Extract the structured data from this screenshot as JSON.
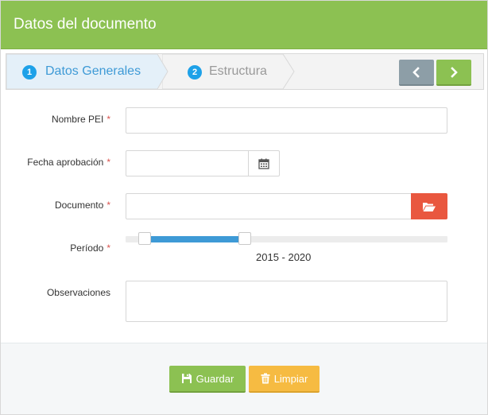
{
  "panel": {
    "title": "Datos del documento"
  },
  "wizard": {
    "steps": [
      {
        "number": "1",
        "label": "Datos Generales",
        "active": true
      },
      {
        "number": "2",
        "label": "Estructura",
        "active": false
      }
    ],
    "prev_icon": "chevron-left-icon",
    "next_icon": "chevron-right-icon"
  },
  "form": {
    "nombre_pei": {
      "label": "Nombre PEI",
      "value": "",
      "required": "*"
    },
    "fecha_aprobacion": {
      "label": "Fecha aprobación",
      "value": "",
      "required": "*",
      "icon": "calendar-icon"
    },
    "documento": {
      "label": "Documento",
      "value": "",
      "required": "*",
      "icon": "folder-open-icon"
    },
    "periodo": {
      "label": "Período",
      "required": "*",
      "range_text": "2015 - 2020",
      "fill_start": 0.06,
      "fill_end": 0.37
    },
    "observaciones": {
      "label": "Observaciones",
      "value": ""
    }
  },
  "footer": {
    "save_label": "Guardar",
    "save_icon": "save-icon",
    "clear_label": "Limpiar",
    "clear_icon": "trash-icon"
  },
  "colors": {
    "header": "#8cc152",
    "active_step": "#3e9ad6",
    "danger": "#e9573f",
    "warning": "#f6bb42"
  }
}
